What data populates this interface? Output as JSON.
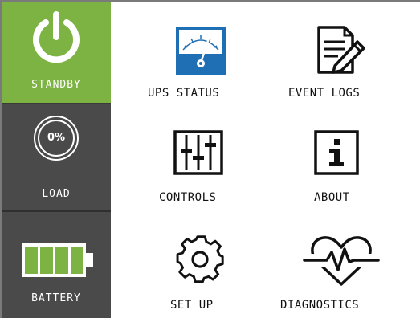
{
  "sidebar": {
    "items": [
      {
        "label": "STANDBY",
        "icon": "power-icon",
        "color": "#7cb342"
      },
      {
        "label": "LOAD",
        "icon": "load-gauge-icon",
        "value": "0%"
      },
      {
        "label": "BATTERY",
        "icon": "battery-icon",
        "color": "#7cb342"
      }
    ]
  },
  "menu": {
    "items": [
      {
        "label": "UPS STATUS",
        "icon": "meter-icon"
      },
      {
        "label": "EVENT LOGS",
        "icon": "document-edit-icon"
      },
      {
        "label": "CONTROLS",
        "icon": "sliders-icon"
      },
      {
        "label": "ABOUT",
        "icon": "info-icon"
      },
      {
        "label": "SET UP",
        "icon": "gear-icon"
      },
      {
        "label": "DIAGNOSTICS",
        "icon": "heartbeat-icon"
      }
    ]
  },
  "colors": {
    "accent": "#7cb342",
    "sidebar_bg": "#4a4a4a",
    "meter_blue": "#1f6fb5"
  }
}
